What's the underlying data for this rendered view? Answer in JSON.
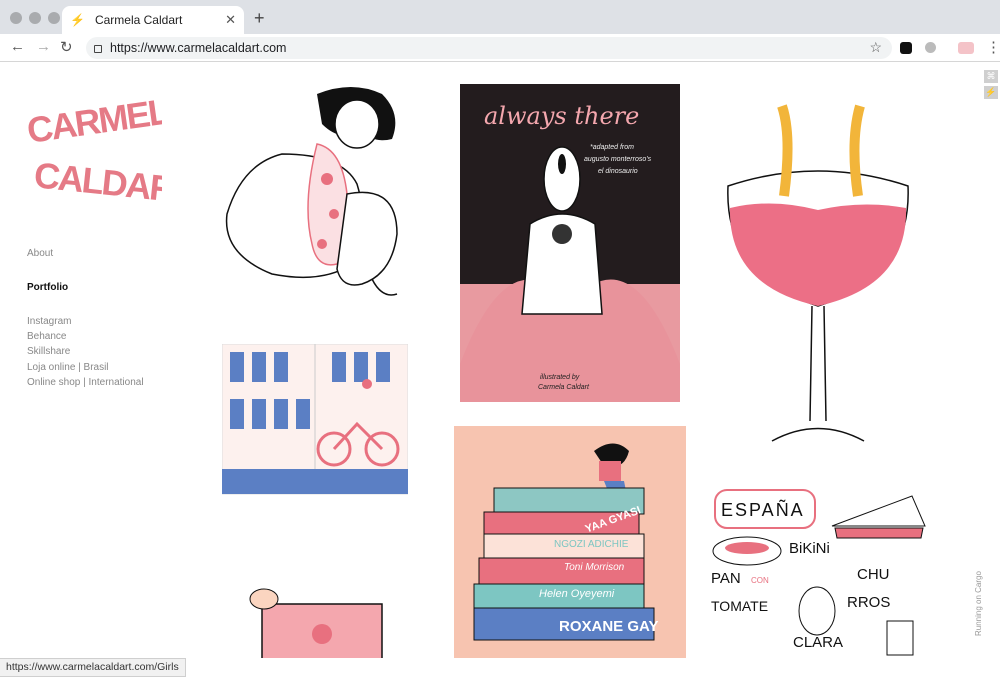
{
  "browser": {
    "tab_title": "Carmela Caldart",
    "url": "https://www.carmelacaldart.com",
    "status_url": "https://www.carmelacaldart.com/Girls"
  },
  "site": {
    "logo_text_line1": "CARMELA",
    "logo_text_line2": "CALDART",
    "nav": {
      "about": "About",
      "portfolio": "Portfolio",
      "instagram": "Instagram",
      "behance": "Behance",
      "skillshare": "Skillshare",
      "loja": "Loja online | Brasil",
      "shop": "Online shop | International"
    },
    "footer_badge": "Running on Cargo"
  },
  "artworks": {
    "always_there": {
      "title": "always there",
      "sub1": "*adapted from",
      "sub2": "augusto monterroso's",
      "sub3": "el dinosaurio",
      "credit1": "illustrated by",
      "credit2": "Carmela Caldart"
    },
    "books": [
      "YAA GYASI",
      "NGOZI ADICHIE",
      "Toni Morrison",
      "Helen Oyeyemi",
      "ROXANE GAY"
    ],
    "espana": {
      "title": "ESPAÑA",
      "w1": "BiKiNi",
      "w2": "PAN",
      "w3": "CON",
      "w4": "TOMATE",
      "w5": "CHU",
      "w6": "RROS",
      "w7": "CLARA"
    }
  },
  "colors": {
    "pink": "#e8707f",
    "light_pink": "#f4a7ae",
    "blue": "#5b7fc4",
    "teal": "#7dc6c2",
    "yellow": "#f2b53a"
  }
}
